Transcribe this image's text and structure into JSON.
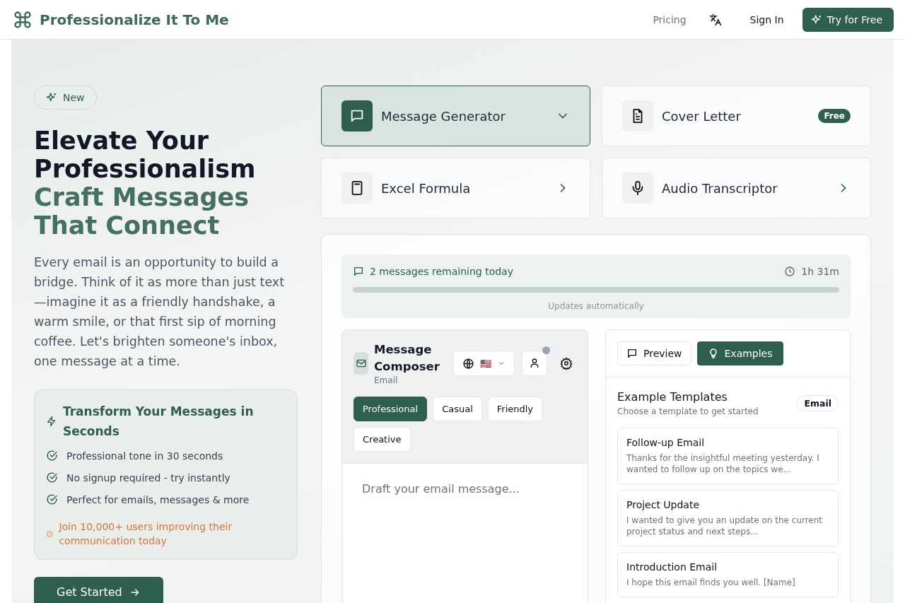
{
  "header": {
    "brand": "Professionalize It To Me",
    "nav": [
      {
        "kind": "link",
        "label": "Pricing"
      },
      {
        "kind": "language"
      },
      {
        "kind": "signin",
        "label": "Sign In"
      },
      {
        "kind": "cta",
        "label": "Try for Free"
      }
    ]
  },
  "hero": {
    "badge": "New",
    "title_lines": [
      "Elevate Your",
      "Professionalism"
    ],
    "accent_lines": [
      "Craft Messages",
      "That Connect"
    ],
    "description": "Every email is an opportunity to build a bridge. Think of it as more than just text—imagine it as a friendly handshake, a warm smile, or that first sip of morning coffee. Let's brighten someone's inbox, one message at a time.",
    "feature_card": {
      "title": "Transform Your Messages in Seconds",
      "items": [
        "Professional tone in 30 seconds",
        "No signup required - try instantly",
        "Perfect for emails, messages & more"
      ],
      "note": "Join 10,000+ users improving their communication today"
    },
    "cta": "Get Started"
  },
  "tools": [
    {
      "label": "Message Generator",
      "selected": true,
      "kind": "dropdown"
    },
    {
      "label": "Cover Letter",
      "selected": false,
      "kind": "badge",
      "badge": "Free"
    },
    {
      "label": "Excel Formula",
      "selected": false,
      "kind": "link"
    },
    {
      "label": "Audio Transcriptor",
      "selected": false,
      "kind": "link"
    }
  ],
  "usage": {
    "remaining": "2 messages remaining today",
    "timer": "1h 31m",
    "level": 1,
    "note": "Updates automatically"
  },
  "composer": {
    "title": "Message Composer",
    "subtitle": "Email",
    "flag": "🇺🇸",
    "tones": [
      {
        "label": "Professional",
        "selected": true
      },
      {
        "label": "Casual",
        "selected": false
      },
      {
        "label": "Friendly",
        "selected": false
      },
      {
        "label": "Creative",
        "selected": false
      }
    ],
    "placeholder": "Draft your email message..."
  },
  "side": {
    "tabs": [
      {
        "label": "Preview",
        "selected": false
      },
      {
        "label": "Examples",
        "selected": true
      }
    ],
    "title": "Example Templates",
    "subtitle": "Choose a template to get started",
    "tag": "Email",
    "templates": [
      {
        "title": "Follow-up Email",
        "body": "Thanks for the insightful meeting yesterday. I wanted to follow up on the topics we..."
      },
      {
        "title": "Project Update",
        "body": "I wanted to give you an update on the current project status and next steps..."
      },
      {
        "title": "Introduction Email",
        "body": "I hope this email finds you well. [Name]"
      }
    ]
  }
}
